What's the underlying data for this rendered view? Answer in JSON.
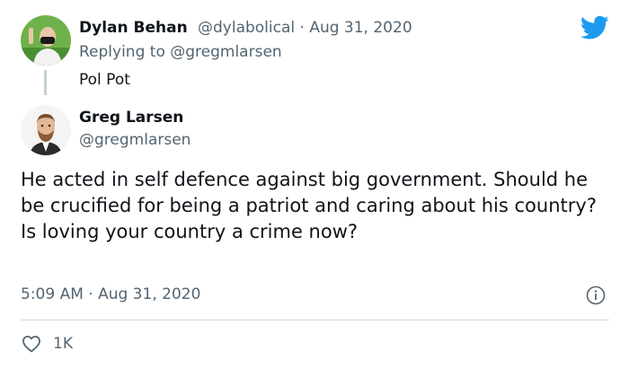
{
  "reply_tweet": {
    "author_name": "Dylan Behan",
    "meta": "@dylabolical · Aug 31, 2020",
    "replying_to": "Replying to @gregmlarsen",
    "text": "Pol Pot"
  },
  "main_tweet": {
    "author_name": "Greg Larsen",
    "author_handle": "@gregmlarsen",
    "text": "He acted in self defence against big government. Should he be crucified for being a patriot and caring about his country? Is loving your country a crime now?",
    "timestamp": "5:09 AM · Aug 31, 2020",
    "like_count": "1K"
  },
  "icons": {
    "brand": "twitter-bird-icon",
    "info": "info-icon",
    "like": "heart-icon"
  },
  "colors": {
    "brand_blue": "#1d9bf0",
    "text_primary": "#0f1419",
    "text_secondary": "#536471",
    "divider": "#cfd9de"
  }
}
